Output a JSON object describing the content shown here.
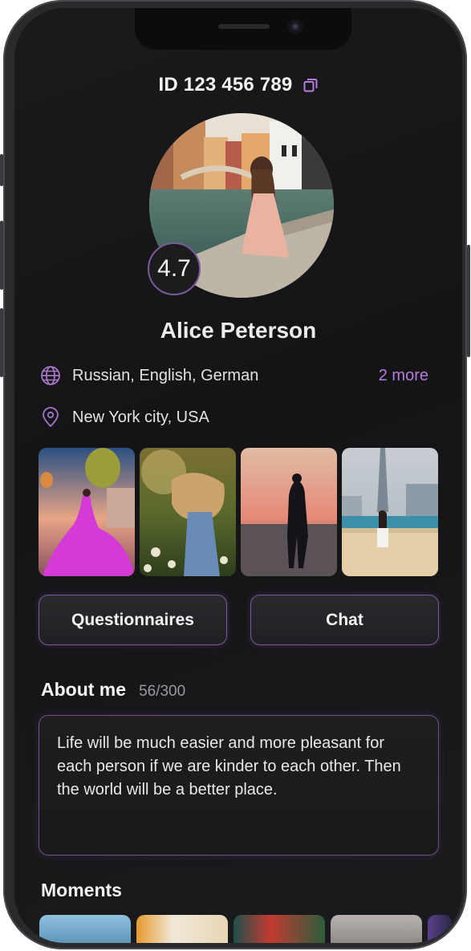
{
  "profile": {
    "id_text": "ID 123 456 789",
    "rating": "4.7",
    "name": "Alice Peterson",
    "languages": "Russian, English, German",
    "languages_more": "2 more",
    "location": "New York city, USA"
  },
  "actions": {
    "questionnaires_label": "Questionnaires",
    "chat_label": "Chat"
  },
  "about": {
    "title": "About me",
    "counter": "56/300",
    "text": "Life will be much easier and more pleasant for each person if we are kinder to each other. Then the world will be a better place."
  },
  "moments": {
    "title": "Moments"
  },
  "icons": {
    "copy": "copy-icon",
    "languages": "globe-icon",
    "location": "map-pin-icon"
  },
  "colors": {
    "accent": "#b67be0",
    "border_accent": "#7b5a9c",
    "background": "#161618",
    "text": "#ececee"
  }
}
